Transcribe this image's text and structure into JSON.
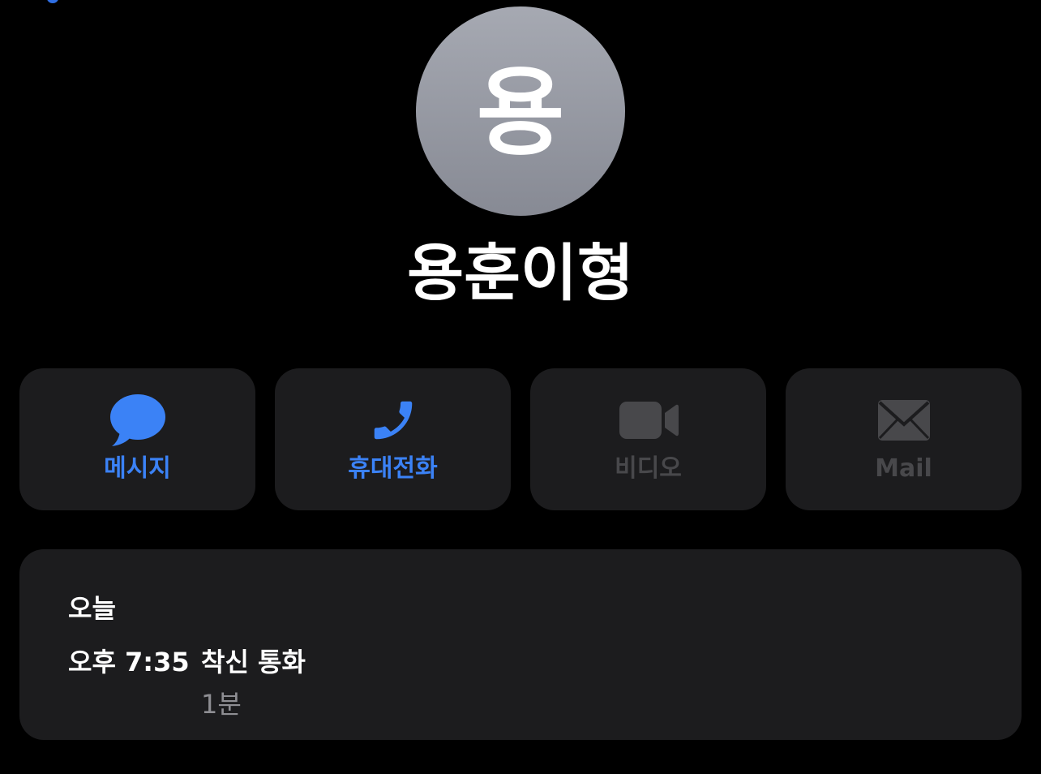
{
  "contact": {
    "initial": "용",
    "name": "용훈이형"
  },
  "actions": [
    {
      "label": "메시지",
      "icon": "message-bubble-icon",
      "enabled": true
    },
    {
      "label": "휴대전화",
      "icon": "phone-icon",
      "enabled": true
    },
    {
      "label": "비디오",
      "icon": "video-camera-icon",
      "enabled": false
    },
    {
      "label": "Mail",
      "icon": "mail-envelope-icon",
      "enabled": false
    }
  ],
  "history": {
    "date": "오늘",
    "time": "오후 7:35",
    "type": "착신 통화",
    "duration": "1분"
  },
  "colors": {
    "background": "#000000",
    "card": "#1c1c1e",
    "accent": "#3b82f6",
    "disabled": "#48484b",
    "secondary_text": "#8e8e93",
    "avatar": "#9a9da6"
  }
}
